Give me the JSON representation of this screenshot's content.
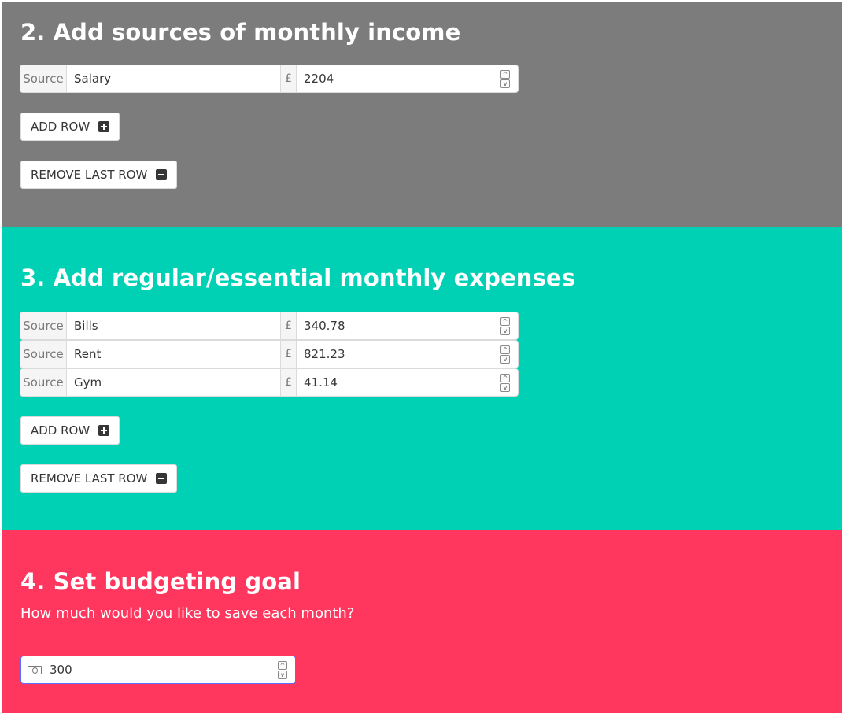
{
  "income": {
    "title": "2. Add sources of monthly income",
    "rows": [
      {
        "source_label": "Source",
        "name": "Salary",
        "currency": "£",
        "amount": "2204"
      }
    ],
    "add_label": "ADD ROW",
    "remove_label": "REMOVE LAST ROW"
  },
  "expenses": {
    "title": "3. Add regular/essential monthly expenses",
    "rows": [
      {
        "source_label": "Source",
        "name": "Bills",
        "currency": "£",
        "amount": "340.78"
      },
      {
        "source_label": "Source",
        "name": "Rent",
        "currency": "£",
        "amount": "821.23"
      },
      {
        "source_label": "Source",
        "name": "Gym",
        "currency": "£",
        "amount": "41.14"
      }
    ],
    "add_label": "ADD ROW",
    "remove_label": "REMOVE LAST ROW"
  },
  "goal": {
    "title": "4. Set budgeting goal",
    "subtitle": "How much would you like to save each month?",
    "value": "300"
  },
  "colors": {
    "income_bg": "#7c7c7c",
    "expenses_bg": "#00d1b5",
    "goal_bg": "#ff365e"
  },
  "icons": {
    "add": "plus-square-icon",
    "remove": "minus-square-icon",
    "money": "money-bill-icon"
  }
}
